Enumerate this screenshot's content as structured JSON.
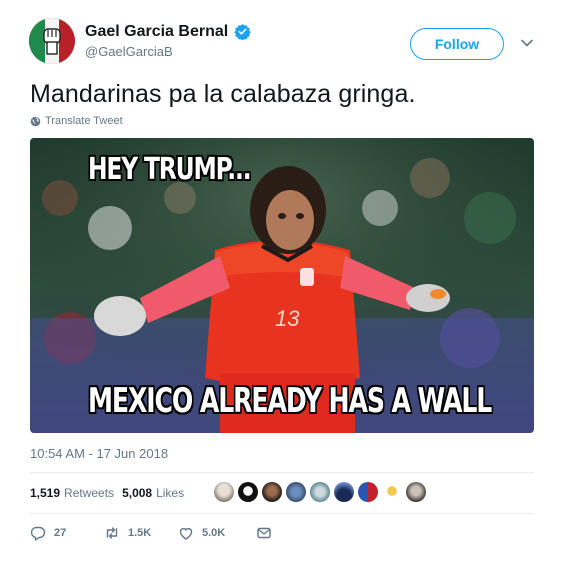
{
  "user": {
    "name": "Gael Garcia Bernal",
    "handle": "@GaelGarciaB",
    "follow_label": "Follow"
  },
  "tweet": {
    "text": "Mandarinas pa la calabaza gringa.",
    "translate_label": "Translate Tweet",
    "timestamp": "10:54 AM - 17 Jun 2018"
  },
  "media": {
    "meme_top": "HEY TRUMP...",
    "meme_bottom": "MEXICO ALREADY HAS A WALL",
    "jersey_number": "13"
  },
  "stats": {
    "retweets_count": "1,519",
    "retweets_label": "Retweets",
    "likes_count": "5,008",
    "likes_label": "Likes"
  },
  "actions": {
    "reply_count": "27",
    "retweet_count": "1.5K",
    "like_count": "5.0K"
  },
  "colors": {
    "accent": "#1da1f2",
    "text_secondary": "#657786"
  },
  "icons": [
    "verified-icon",
    "chevron-down-icon",
    "globe-icon",
    "reply-icon",
    "retweet-icon",
    "heart-icon",
    "message-icon"
  ]
}
